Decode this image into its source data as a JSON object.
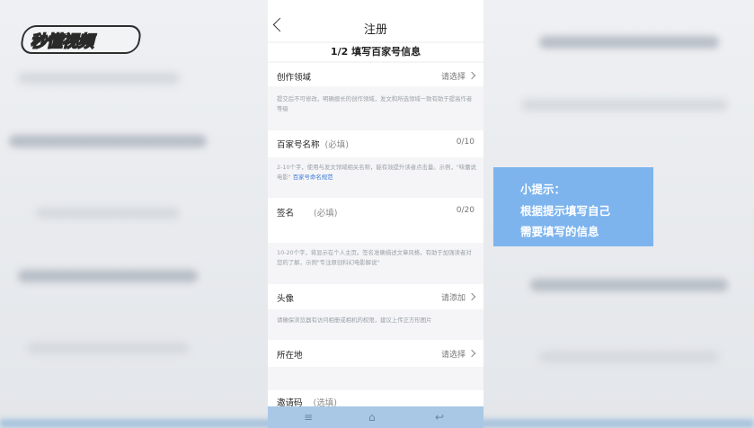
{
  "watermark": {
    "text": "秒懂视频"
  },
  "header": {
    "back_icon": "chevron-left-icon",
    "title": "注册"
  },
  "step": {
    "text": "1/2 填写百家号信息"
  },
  "fields": [
    {
      "label": "创作领域",
      "required": "",
      "right": "请选择",
      "hint": "提交后不可修改，明确擅长的创作领域，发文和所选领域一致有助于提高作者等级"
    },
    {
      "label": "百家号名称",
      "required": "(必填)",
      "right": "0/10",
      "hint": "2-10个字，使用与发文领域相关名称，能有效提升读者点击量。示例，\"味蕾说电影\"",
      "hint_link": "百家号命名规范"
    },
    {
      "label": "签名",
      "required": "(必填)",
      "right": "0/20",
      "hint": "10-20个字，将显示在个人主页。签名准确描述文章风格，有助于加强读者对您的了解，示例\"专注原创科幻电影解说\""
    },
    {
      "label": "头像",
      "required": "",
      "right": "请添加",
      "hint": "请确保浏览器有访问相册或相机的权限，建议上传正方形图片"
    },
    {
      "label": "所在地",
      "required": "",
      "right": "请选择",
      "hint": ""
    },
    {
      "label": "邀请码",
      "required": "(选填)",
      "right": "",
      "hint": ""
    }
  ],
  "navbar": {
    "icons": [
      "menu-icon",
      "home-icon",
      "back-icon"
    ]
  },
  "tip": {
    "line1": "小提示：",
    "line2": "根据提示填写自己",
    "line3": "需要填写的信息"
  },
  "colors": {
    "tip_bg": "#7db4ee",
    "navbar_bg": "#a8c8e6",
    "link": "#3b78d8"
  }
}
